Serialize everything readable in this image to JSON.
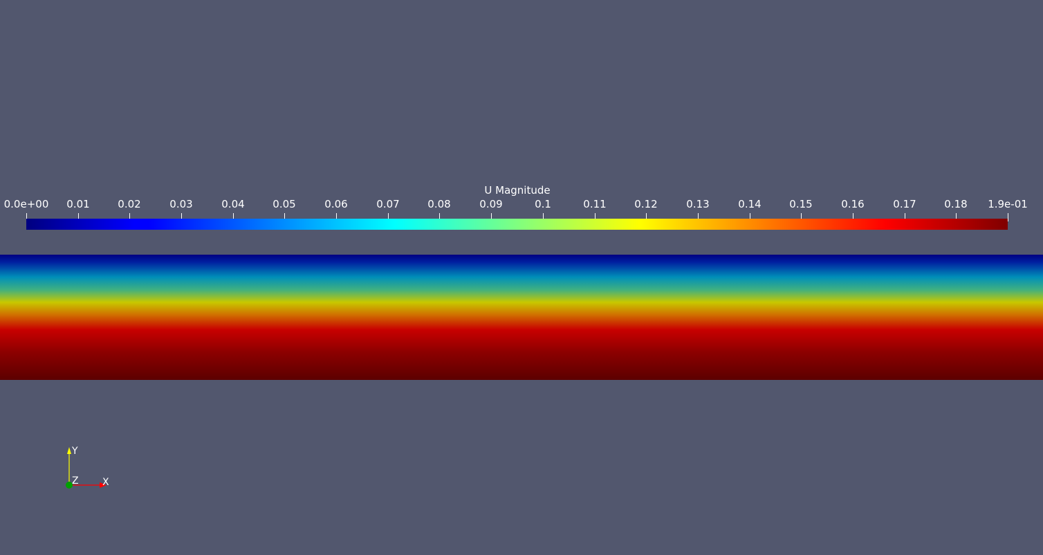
{
  "scalar_bar": {
    "title": "U Magnitude",
    "tick_labels": [
      "0.0e+00",
      "0.01",
      "0.02",
      "0.03",
      "0.04",
      "0.05",
      "0.06",
      "0.07",
      "0.08",
      "0.09",
      "0.1",
      "0.11",
      "0.12",
      "0.13",
      "0.14",
      "0.15",
      "0.16",
      "0.17",
      "0.18",
      "1.9e-01"
    ],
    "tick_values": [
      0,
      0.01,
      0.02,
      0.03,
      0.04,
      0.05,
      0.06,
      0.07,
      0.08,
      0.09,
      0.1,
      0.11,
      0.12,
      0.13,
      0.14,
      0.15,
      0.16,
      0.17,
      0.18,
      0.19
    ],
    "range": [
      0,
      0.19
    ],
    "colormap": "jet",
    "colormap_stops": [
      "#00007f",
      "#0000ff",
      "#00ffff",
      "#ffff00",
      "#ff0000",
      "#7f0000"
    ]
  },
  "field": {
    "colors_top_to_bottom": [
      "#000082",
      "#008fb8",
      "#c8c800",
      "#c80000",
      "#5c0000"
    ]
  },
  "axes": {
    "x_label": "X",
    "y_label": "Y",
    "z_label": "Z",
    "x_color": "#ff0000",
    "y_color": "#ffff00",
    "z_color": "#00a000"
  },
  "background_color": "#52576e"
}
